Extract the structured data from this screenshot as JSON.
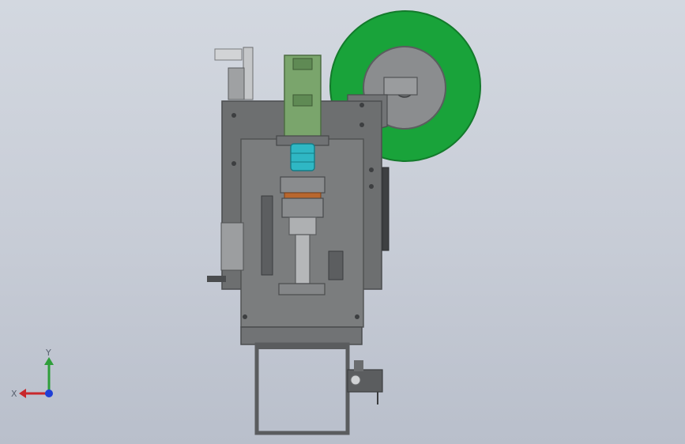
{
  "viewport": {
    "background_top": "#d3d8e0",
    "background_bottom": "#b9bfcb"
  },
  "model": {
    "frame_color": "#6d6f70",
    "frame_dark": "#4f5152",
    "wheel_color": "#19a33a",
    "hub_color": "#8b8d8f",
    "slide_color": "#7aa56c",
    "coupling_color": "#2fb7c4",
    "plate_color": "#b8672e"
  },
  "triad": {
    "x_label": "X",
    "y_label": "Y",
    "x_color": "#c8282c",
    "y_color": "#2f9e3a",
    "z_color": "#1f3fd6"
  }
}
